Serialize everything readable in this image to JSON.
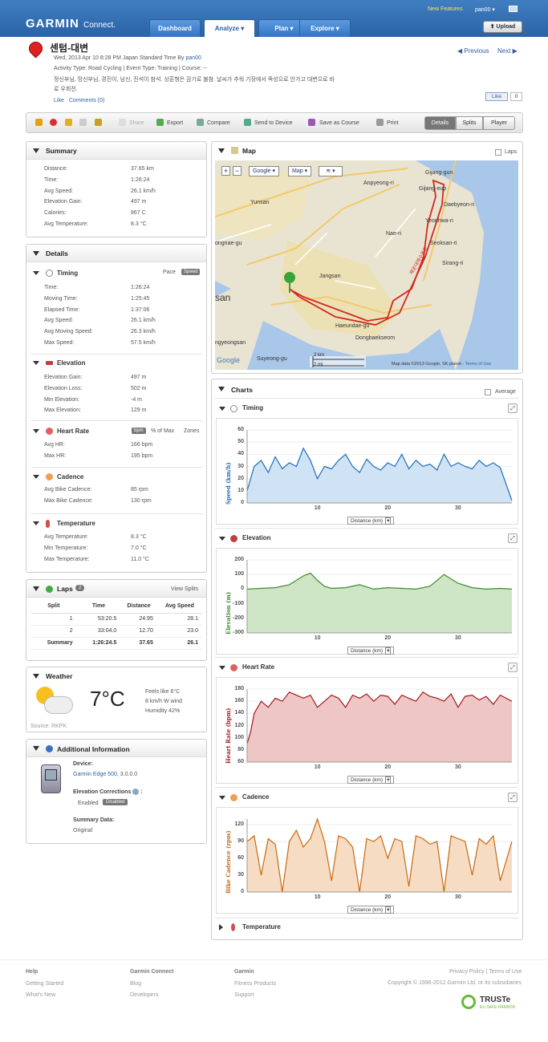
{
  "header": {
    "logo": "GARMIN",
    "logo_sub": "Connect.",
    "new_features": "New Features",
    "user": "pan00 ▾",
    "upload": "⬆ Upload",
    "tabs": [
      "Dashboard",
      "Analyze ▾",
      "Plan ▾",
      "Explore ▾"
    ]
  },
  "activity": {
    "title": "센텀-대변",
    "meta1_prefix": "Wed, 2013 Apr 10 8:28 PM Japan Standard Time By ",
    "meta1_user": "pan00",
    "meta2": "Activity Type: Road Cycling | Event Type: Training | Course: --",
    "desc1": "정신부님, 망신부님, 경진이, 남신, 진석이 참석. 상훈형은 감기로 불참. 날씨가 추워 기장에서 죽성으로 안가고 대변으로 바",
    "desc2": "로 우회전.",
    "like": "Like",
    "comments": "Comments (0)",
    "prev": "Previous",
    "next": "Next",
    "fb_like": "Like",
    "fb_count": "0"
  },
  "toolbar": {
    "share": "Share",
    "export": "Export",
    "compare": "Compare",
    "send": "Send to Device",
    "save_course": "Save as Course",
    "print": "Print",
    "views": [
      "Details",
      "Splits",
      "Player"
    ]
  },
  "summary": {
    "title": "Summary",
    "rows": [
      {
        "k": "Distance:",
        "v": "37.65 km"
      },
      {
        "k": "Time:",
        "v": "1:26:24"
      },
      {
        "k": "Avg Speed:",
        "v": "26.1 km/h"
      },
      {
        "k": "Elevation Gain:",
        "v": "497 m"
      },
      {
        "k": "Calories:",
        "v": "867 C"
      },
      {
        "k": "Avg Temperature:",
        "v": "8.3 °C"
      }
    ]
  },
  "details": {
    "title": "Details",
    "timing": {
      "title": "Timing",
      "pace": "Pace",
      "speed": "Speed",
      "rows": [
        {
          "k": "Time:",
          "v": "1:26:24"
        },
        {
          "k": "Moving Time:",
          "v": "1:25:45"
        },
        {
          "k": "Elapsed Time:",
          "v": "1:37:06"
        },
        {
          "k": "Avg Speed:",
          "v": "26.1 km/h"
        },
        {
          "k": "Avg Moving Speed:",
          "v": "26.3 km/h"
        },
        {
          "k": "Max Speed:",
          "v": "57.5 km/h"
        }
      ]
    },
    "elevation": {
      "title": "Elevation",
      "rows": [
        {
          "k": "Elevation Gain:",
          "v": "497 m"
        },
        {
          "k": "Elevation Loss:",
          "v": "502 m"
        },
        {
          "k": "Min Elevation:",
          "v": "-4 m"
        },
        {
          "k": "Max Elevation:",
          "v": "129 m"
        }
      ]
    },
    "hr": {
      "title": "Heart Rate",
      "bpm": "bpm",
      "max": "% of Max",
      "zones": "Zones",
      "rows": [
        {
          "k": "Avg HR:",
          "v": "166 bpm"
        },
        {
          "k": "Max HR:",
          "v": "195 bpm"
        }
      ]
    },
    "cadence": {
      "title": "Cadence",
      "rows": [
        {
          "k": "Avg Bike Cadence:",
          "v": "85 rpm"
        },
        {
          "k": "Max Bike Cadence:",
          "v": "130 rpm"
        }
      ]
    },
    "temperature": {
      "title": "Temperature",
      "rows": [
        {
          "k": "Avg Temperature:",
          "v": "8.3 °C"
        },
        {
          "k": "Min Temperature:",
          "v": "7.0 °C"
        },
        {
          "k": "Max Temperature:",
          "v": "11.0 °C"
        }
      ]
    }
  },
  "laps": {
    "title": "Laps",
    "count": "2",
    "view_splits": "View Splits",
    "headers": [
      "Split",
      "Time",
      "Distance",
      "Avg Speed"
    ],
    "rows": [
      [
        "1",
        "53:20.5",
        "24.95",
        "28.1"
      ],
      [
        "2",
        "33:04.0",
        "12.70",
        "23.0"
      ],
      [
        "Summary",
        "1:26:24.5",
        "37.65",
        "26.1"
      ]
    ]
  },
  "weather": {
    "title": "Weather",
    "temp": "7°C",
    "feels": "Feels like 6°C",
    "wind": "8 km/h W wind",
    "humidity": "Humidity 42%",
    "source": "Source: RKPK"
  },
  "additional": {
    "title": "Additional Information",
    "device_label": "Device:",
    "device": "Garmin Edge 500",
    "device_ver": ", 3.0.0.0",
    "elev_corr": "Elevation Corrections",
    "enabled": "Enabled",
    "disabled": "Disabled",
    "summary_label": "Summary Data:",
    "summary_val": "Original"
  },
  "map": {
    "title": "Map",
    "laps": "Laps",
    "google": "Google",
    "maptype": "Map",
    "labels": [
      "Gijang-gun",
      "Anpyeong-ri",
      "Gijang-eup",
      "Daebyeon-ri",
      "Yeonhwa-ri",
      "Nae-ri",
      "Seoksan-ri",
      "Sirang-ri",
      "Yunsan",
      "Jangsan",
      "ongnae-gu",
      "san",
      "Haeundae-gu",
      "Dongbaekseom",
      "ngyeongsan",
      "Suyeong-gu",
      "Google"
    ],
    "scale_km": "2 km",
    "scale_mi": "2 mi",
    "copyright": "Map data ©2013 Google, SK planet - ",
    "terms": "Terms of Use",
    "route_label": "해운대해수욕장"
  },
  "charts": {
    "title": "Charts",
    "average": "Average",
    "xlabel": "Distance (km)",
    "temperature_title": "Temperature"
  },
  "chart_data": [
    {
      "type": "area",
      "title": "Timing",
      "ylabel": "Speed (km/h)",
      "xlabel": "Distance (km)",
      "ylim": [
        0,
        60
      ],
      "yticks": [
        0,
        10,
        20,
        30,
        40,
        50,
        60
      ],
      "xticks": [
        10,
        20,
        30
      ],
      "xlim": [
        0,
        37.65
      ],
      "color": "#1f6fb8",
      "fill": "#cfe3f5",
      "x": [
        0,
        1,
        2,
        3,
        4,
        5,
        6,
        7,
        8,
        9,
        10,
        11,
        12,
        13,
        14,
        15,
        16,
        17,
        18,
        19,
        20,
        21,
        22,
        23,
        24,
        25,
        26,
        27,
        28,
        29,
        30,
        31,
        32,
        33,
        34,
        35,
        36,
        37.65
      ],
      "y": [
        10,
        30,
        35,
        25,
        38,
        28,
        33,
        30,
        45,
        35,
        20,
        30,
        28,
        35,
        40,
        30,
        25,
        36,
        30,
        27,
        33,
        30,
        40,
        28,
        35,
        30,
        32,
        27,
        40,
        30,
        33,
        30,
        28,
        35,
        30,
        33,
        29,
        2
      ]
    },
    {
      "type": "area",
      "title": "Elevation",
      "ylabel": "Elevation (m)",
      "xlabel": "Distance (km)",
      "ylim": [
        -300,
        200
      ],
      "yticks": [
        -300,
        -200,
        -100,
        0,
        100,
        200
      ],
      "xticks": [
        10,
        20,
        30
      ],
      "xlim": [
        0,
        37.65
      ],
      "color": "#3e8a2e",
      "fill": "#cfe6c6",
      "x": [
        0,
        2,
        4,
        6,
        8,
        9,
        10,
        11,
        12,
        14,
        16,
        18,
        20,
        22,
        24,
        26,
        28,
        30,
        32,
        34,
        36,
        37.65
      ],
      "y": [
        0,
        5,
        10,
        30,
        90,
        110,
        60,
        20,
        5,
        10,
        30,
        0,
        10,
        5,
        0,
        20,
        100,
        40,
        10,
        0,
        5,
        0
      ]
    },
    {
      "type": "area",
      "title": "Heart Rate",
      "ylabel": "Heart Rate (bpm)",
      "xlabel": "Distance (km)",
      "ylim": [
        60,
        180
      ],
      "yticks": [
        60,
        80,
        100,
        120,
        140,
        160,
        180
      ],
      "xticks": [
        10,
        20,
        30
      ],
      "xlim": [
        0,
        37.65
      ],
      "color": "#a31a1a",
      "fill": "#efc6c6",
      "x": [
        0,
        0.5,
        1,
        2,
        3,
        4,
        5,
        6,
        7,
        8,
        9,
        10,
        11,
        12,
        13,
        14,
        15,
        16,
        17,
        18,
        19,
        20,
        21,
        22,
        23,
        24,
        25,
        26,
        27,
        28,
        29,
        30,
        31,
        32,
        33,
        34,
        35,
        36,
        37.65
      ],
      "y": [
        90,
        110,
        140,
        160,
        150,
        165,
        160,
        175,
        170,
        165,
        170,
        150,
        160,
        170,
        165,
        150,
        170,
        165,
        172,
        160,
        170,
        168,
        155,
        170,
        165,
        160,
        175,
        168,
        165,
        160,
        172,
        150,
        168,
        170,
        162,
        168,
        155,
        170,
        160
      ]
    },
    {
      "type": "line",
      "title": "Cadence",
      "ylabel": "Bike Cadence (rpm)",
      "xlabel": "Distance (km)",
      "ylim": [
        0,
        130
      ],
      "yticks": [
        0,
        30,
        60,
        90,
        120
      ],
      "xticks": [
        10,
        20,
        30
      ],
      "xlim": [
        0,
        37.65
      ],
      "color": "#c86a14",
      "fill": "#f6dcc2",
      "x": [
        0,
        1,
        2,
        3,
        4,
        5,
        6,
        7,
        8,
        9,
        10,
        11,
        12,
        13,
        14,
        15,
        16,
        17,
        18,
        19,
        20,
        21,
        22,
        23,
        24,
        25,
        26,
        27,
        28,
        29,
        30,
        31,
        32,
        33,
        34,
        35,
        36,
        37.65
      ],
      "y": [
        90,
        100,
        30,
        95,
        85,
        0,
        90,
        110,
        80,
        95,
        130,
        90,
        20,
        100,
        95,
        80,
        0,
        95,
        90,
        100,
        60,
        95,
        90,
        10,
        100,
        95,
        85,
        90,
        0,
        100,
        95,
        90,
        30,
        95,
        85,
        100,
        20,
        90
      ]
    }
  ],
  "footer": {
    "col1": [
      "Help",
      "Getting Started",
      "What's New"
    ],
    "col2": [
      "Garmin Connect",
      "Blog",
      "Developers"
    ],
    "col3": [
      "Garmin",
      "Fitness Products",
      "Support"
    ],
    "privacy": "Privacy Policy | Terms of Use",
    "copyright": "Copyright © 1996-2012 Garmin Ltd. or its subsidiaries",
    "truste": "TRUSTe",
    "truste_sub": "EU SAFE HARBOR"
  }
}
